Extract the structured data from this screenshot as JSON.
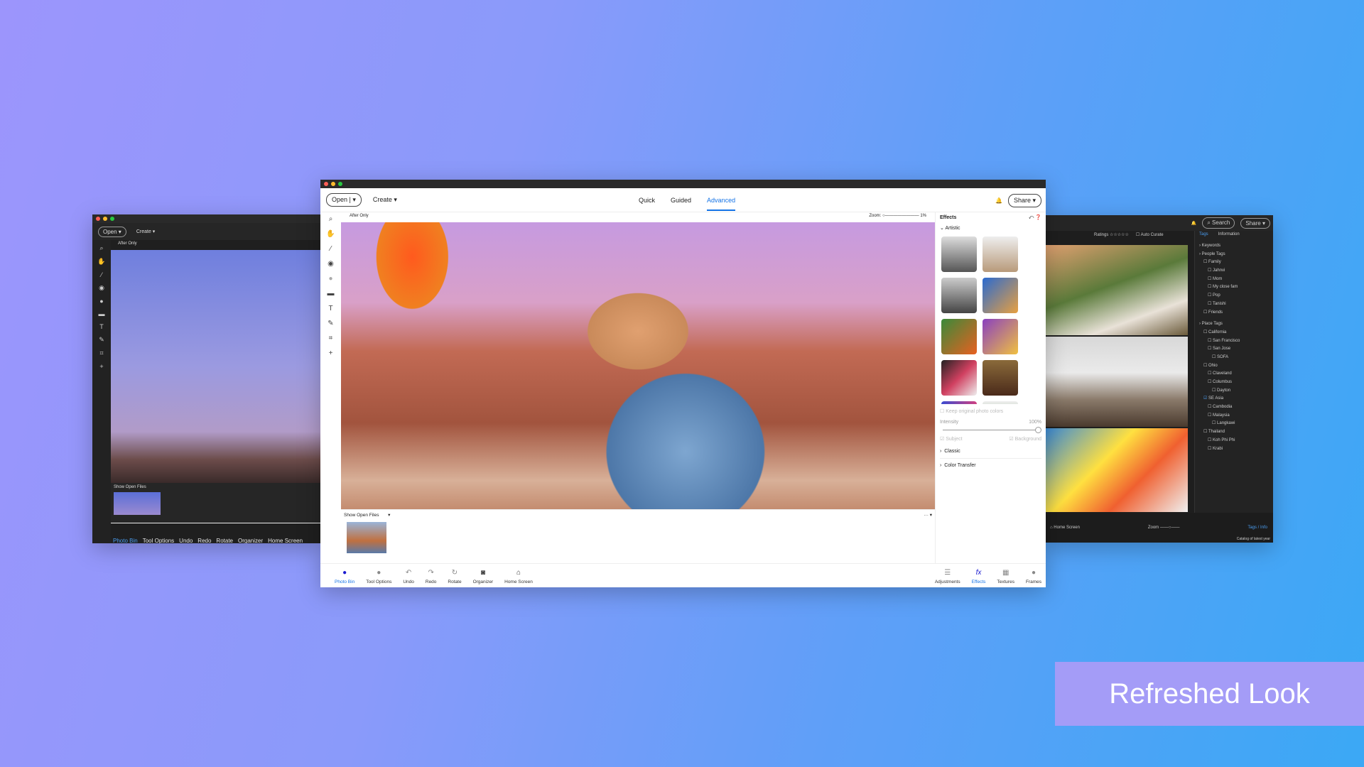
{
  "left_window": {
    "open": "Open",
    "create": "Create",
    "view": "After Only",
    "show_open_files": "Show Open Files",
    "bottom": [
      "Photo Bin",
      "Tool Options",
      "Undo",
      "Redo",
      "Rotate",
      "Organizer",
      "Home Screen"
    ]
  },
  "main_window": {
    "open": "Open",
    "create": "Create",
    "modes": [
      "Quick",
      "Guided",
      "Advanced"
    ],
    "active_mode": "Advanced",
    "share": "Share",
    "view": "After Only",
    "zoom_label": "Zoom:",
    "zoom_value": "1%",
    "effects": {
      "title": "Effects",
      "section": "Artistic",
      "keep_colors": "Keep original photo colors",
      "intensity_label": "Intensity",
      "intensity_value": "100%",
      "subject": "Subject",
      "background": "Background",
      "classic": "Classic",
      "color_transfer": "Color Transfer"
    },
    "show_open_files": "Show Open Files",
    "bottom_left": [
      "Photo Bin",
      "Tool Options",
      "Undo",
      "Redo",
      "Rotate",
      "Organizer",
      "Home Screen"
    ],
    "bottom_right": [
      "Adjustments",
      "Effects",
      "Textures",
      "Frames"
    ],
    "accent": "#1473e6"
  },
  "right_window": {
    "search": "Search",
    "share": "Share",
    "ratings": "Ratings",
    "auto_curate": "Auto Curate",
    "tabs": [
      "Tags",
      "Information"
    ],
    "tags": [
      "Keywords",
      "People Tags",
      "Family",
      "Jahnvi",
      "Mom",
      "My close fam",
      "Pop",
      "Tanishi",
      "Friends",
      "Place Tags",
      "California",
      "San Francisco",
      "San Jose",
      "SOFA",
      "Ohio",
      "Claveland",
      "Columbus",
      "Dayton",
      "SE Asia",
      "Cambodia",
      "Malaysia",
      "Langkawi",
      "Thailand",
      "Koh Phi Phi",
      "Krabi"
    ],
    "checked_tag": "SE Asia",
    "home": "Home Screen",
    "zoom": "Zoom",
    "tags_info": "Tags / Info",
    "catalog": "Catalog of latest year"
  },
  "banner": "Refreshed Look"
}
